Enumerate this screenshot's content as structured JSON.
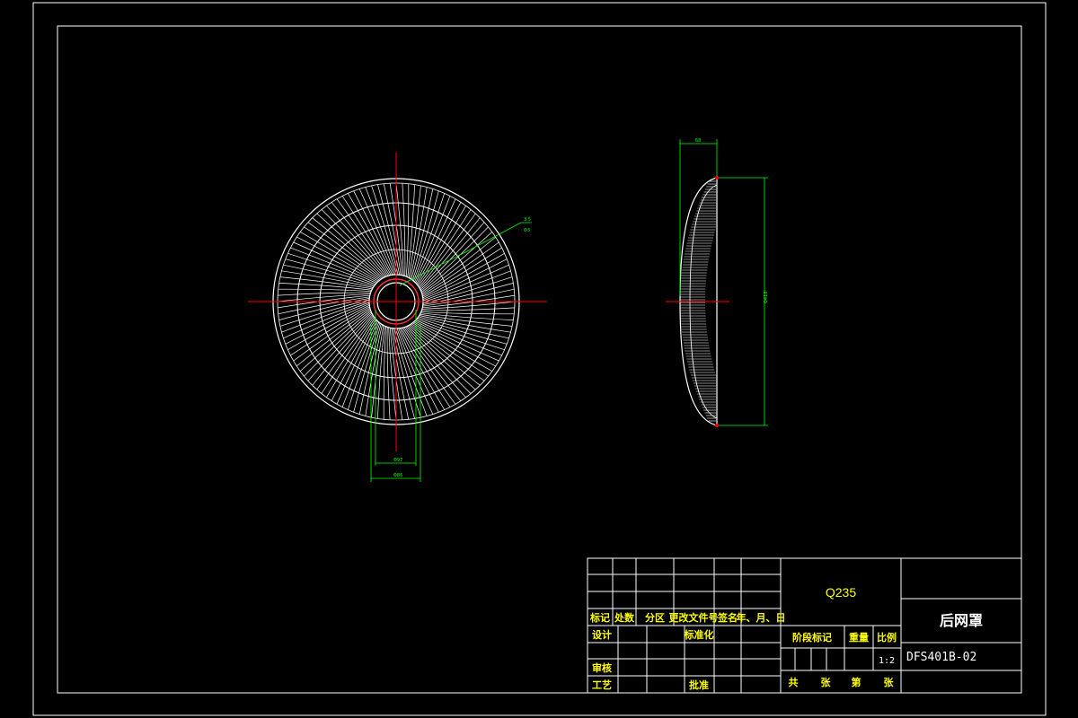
{
  "drawing": {
    "colors": {
      "background": "#000000",
      "border": "#ffffff",
      "geometry": "#ffffff",
      "centerline": "#ff0000",
      "dimension": "#00ff00",
      "titleblock_text": "#ffff00"
    },
    "dimensions": {
      "front_inner_dia": "Φ97",
      "front_outer_dia": "Φ86",
      "leader_note_top": "3.5",
      "leader_note_bottom": "Φ3",
      "side_depth": "68",
      "side_height": "Φ418"
    }
  },
  "title_block": {
    "material": "Q235",
    "part_name": "后网罩",
    "drawing_number": "DFS401B-02",
    "scale_value": "1:2",
    "revision_headers": {
      "mark": "标记",
      "count": "处数",
      "zone": "分区",
      "change_doc": "更改文件号",
      "signature": "签名",
      "date": "年、月、日"
    },
    "roles": {
      "design": "设计",
      "standardization": "标准化",
      "review": "审核",
      "process": "工艺",
      "approve": "批准"
    },
    "stage_headers": {
      "stage_mark": "阶段标记",
      "weight": "重量",
      "scale": "比例"
    },
    "sheet_line": {
      "total": "共",
      "sheets1": "张",
      "number": "第",
      "sheets2": "张"
    }
  }
}
